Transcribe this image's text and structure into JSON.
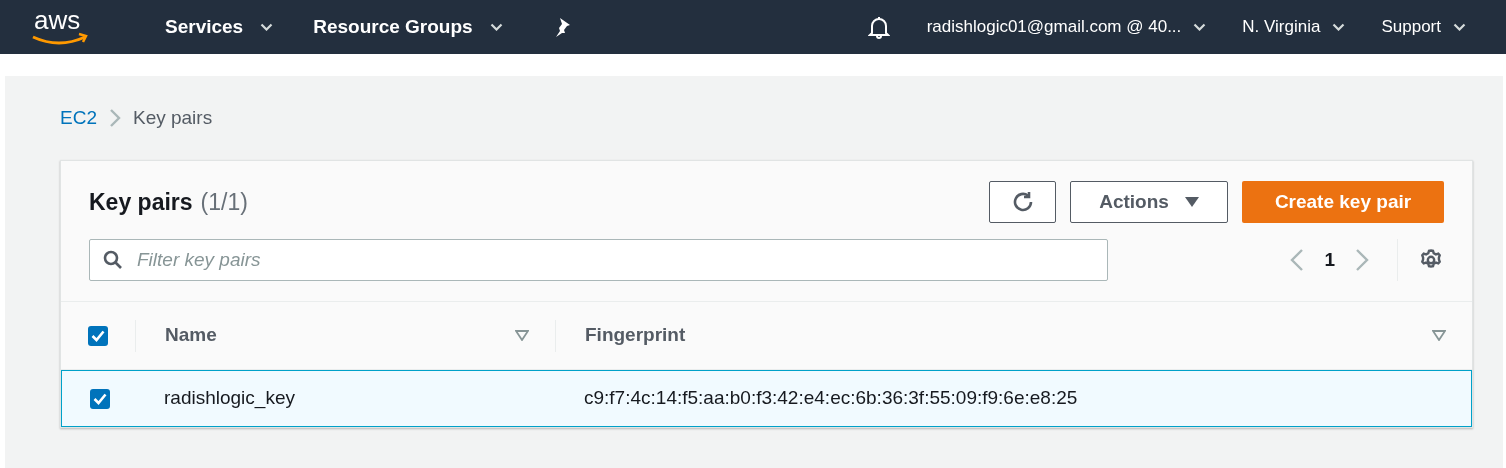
{
  "nav": {
    "logo": "aws",
    "menus": [
      {
        "label": "Services"
      },
      {
        "label": "Resource Groups"
      }
    ],
    "right_menus": [
      {
        "label": "radishlogic01@gmail.com @ 40..."
      },
      {
        "label": "N. Virginia"
      },
      {
        "label": "Support"
      }
    ]
  },
  "breadcrumb": [
    {
      "label": "EC2",
      "kind": "link"
    },
    {
      "label": "Key pairs",
      "kind": "current"
    }
  ],
  "panel": {
    "title": "Key pairs",
    "count": "(1/1)",
    "actions_button": "Actions",
    "create_button": "Create key pair",
    "search": {
      "placeholder": "Filter key pairs"
    },
    "page": "1"
  },
  "table": {
    "select_all": {
      "checked": true
    },
    "columns": [
      {
        "label": "Name"
      },
      {
        "label": "Fingerprint"
      }
    ],
    "rows": [
      {
        "selected": true,
        "checked": true,
        "cells": [
          "radishlogic_key",
          "c9:f7:4c:14:f5:aa:b0:f3:42:e4:ec:6b:36:3f:55:09:f9:6e:e8:25"
        ]
      }
    ]
  }
}
